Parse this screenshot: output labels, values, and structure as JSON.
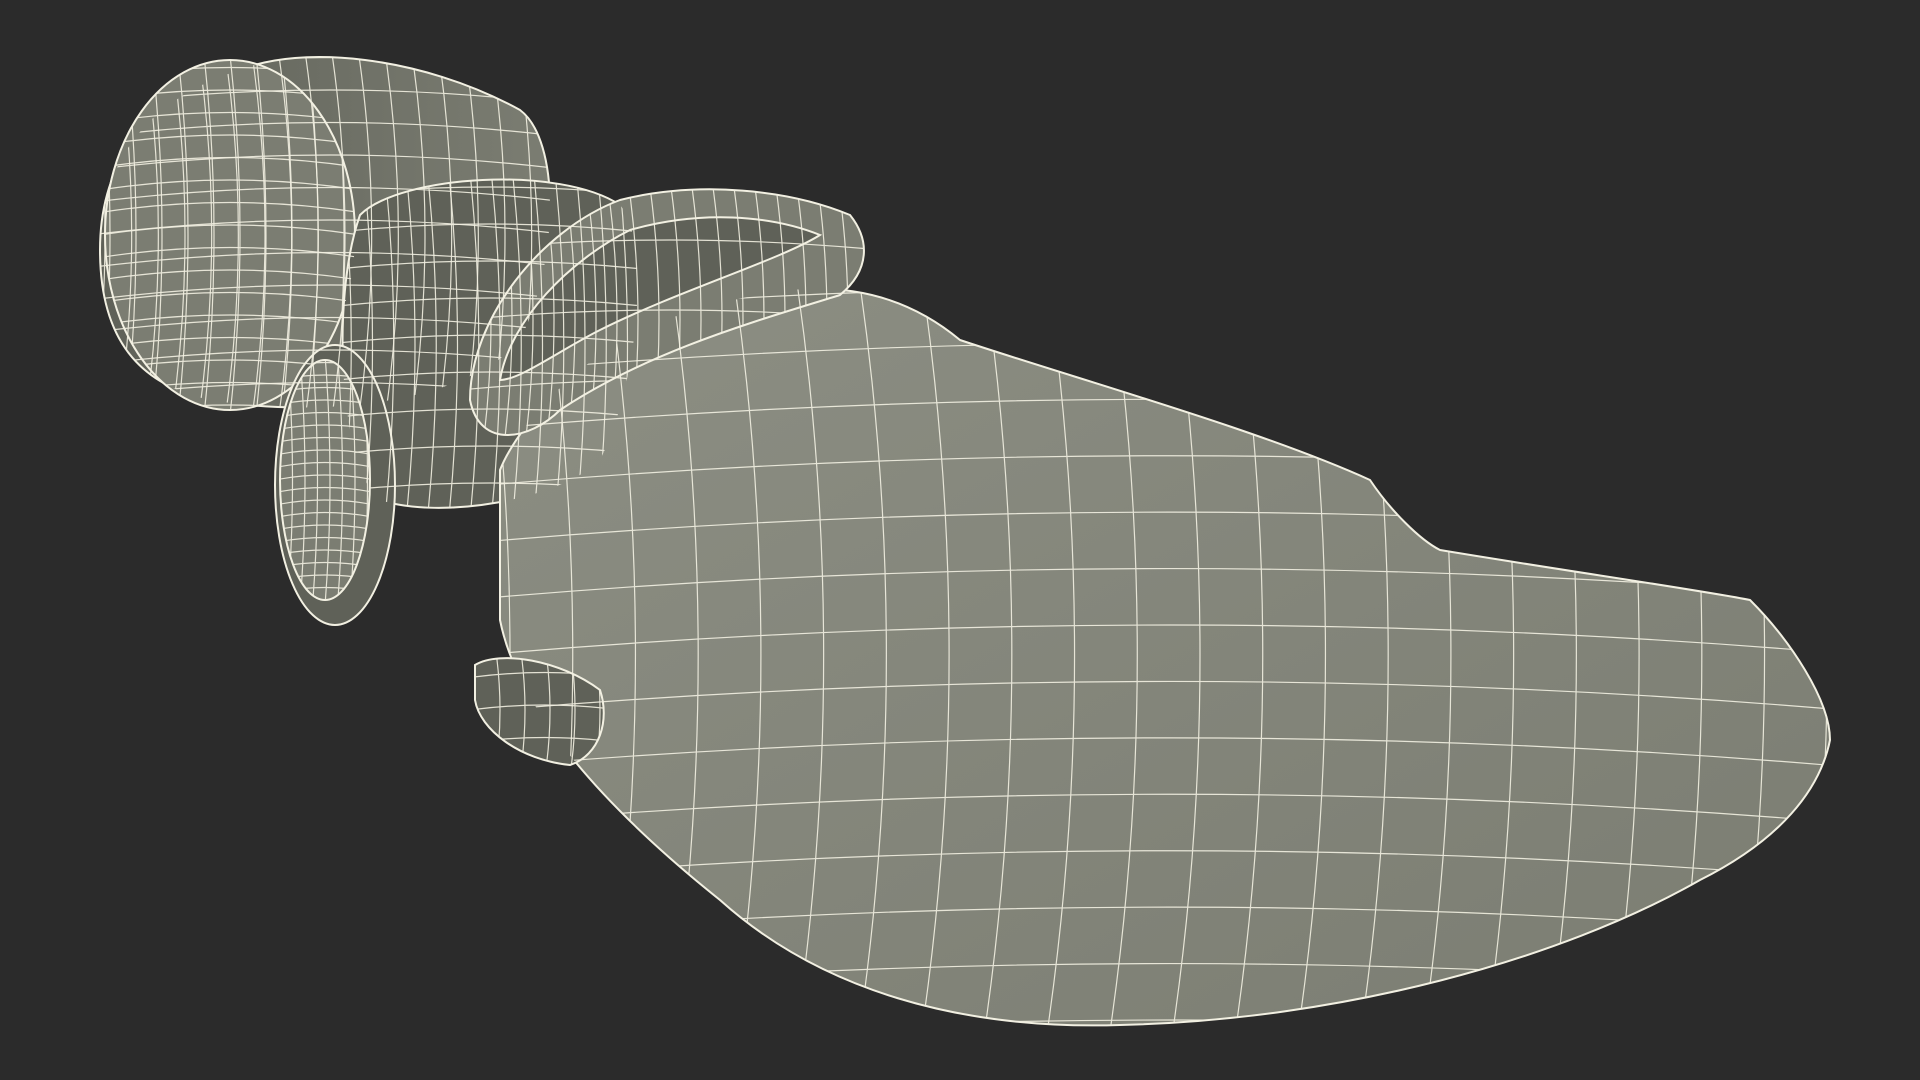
{
  "scene": {
    "subject": "wireframe-render",
    "colors": {
      "background": "#2b2b2b",
      "surface": "#7b7d72",
      "surface_dark": "#5f6158",
      "surface_light": "#8c8e83",
      "wire": "#f2f0e2"
    },
    "parts": [
      "cap",
      "neck-ring",
      "disc",
      "strap-loop",
      "body",
      "spout",
      "bottom-ring"
    ]
  }
}
